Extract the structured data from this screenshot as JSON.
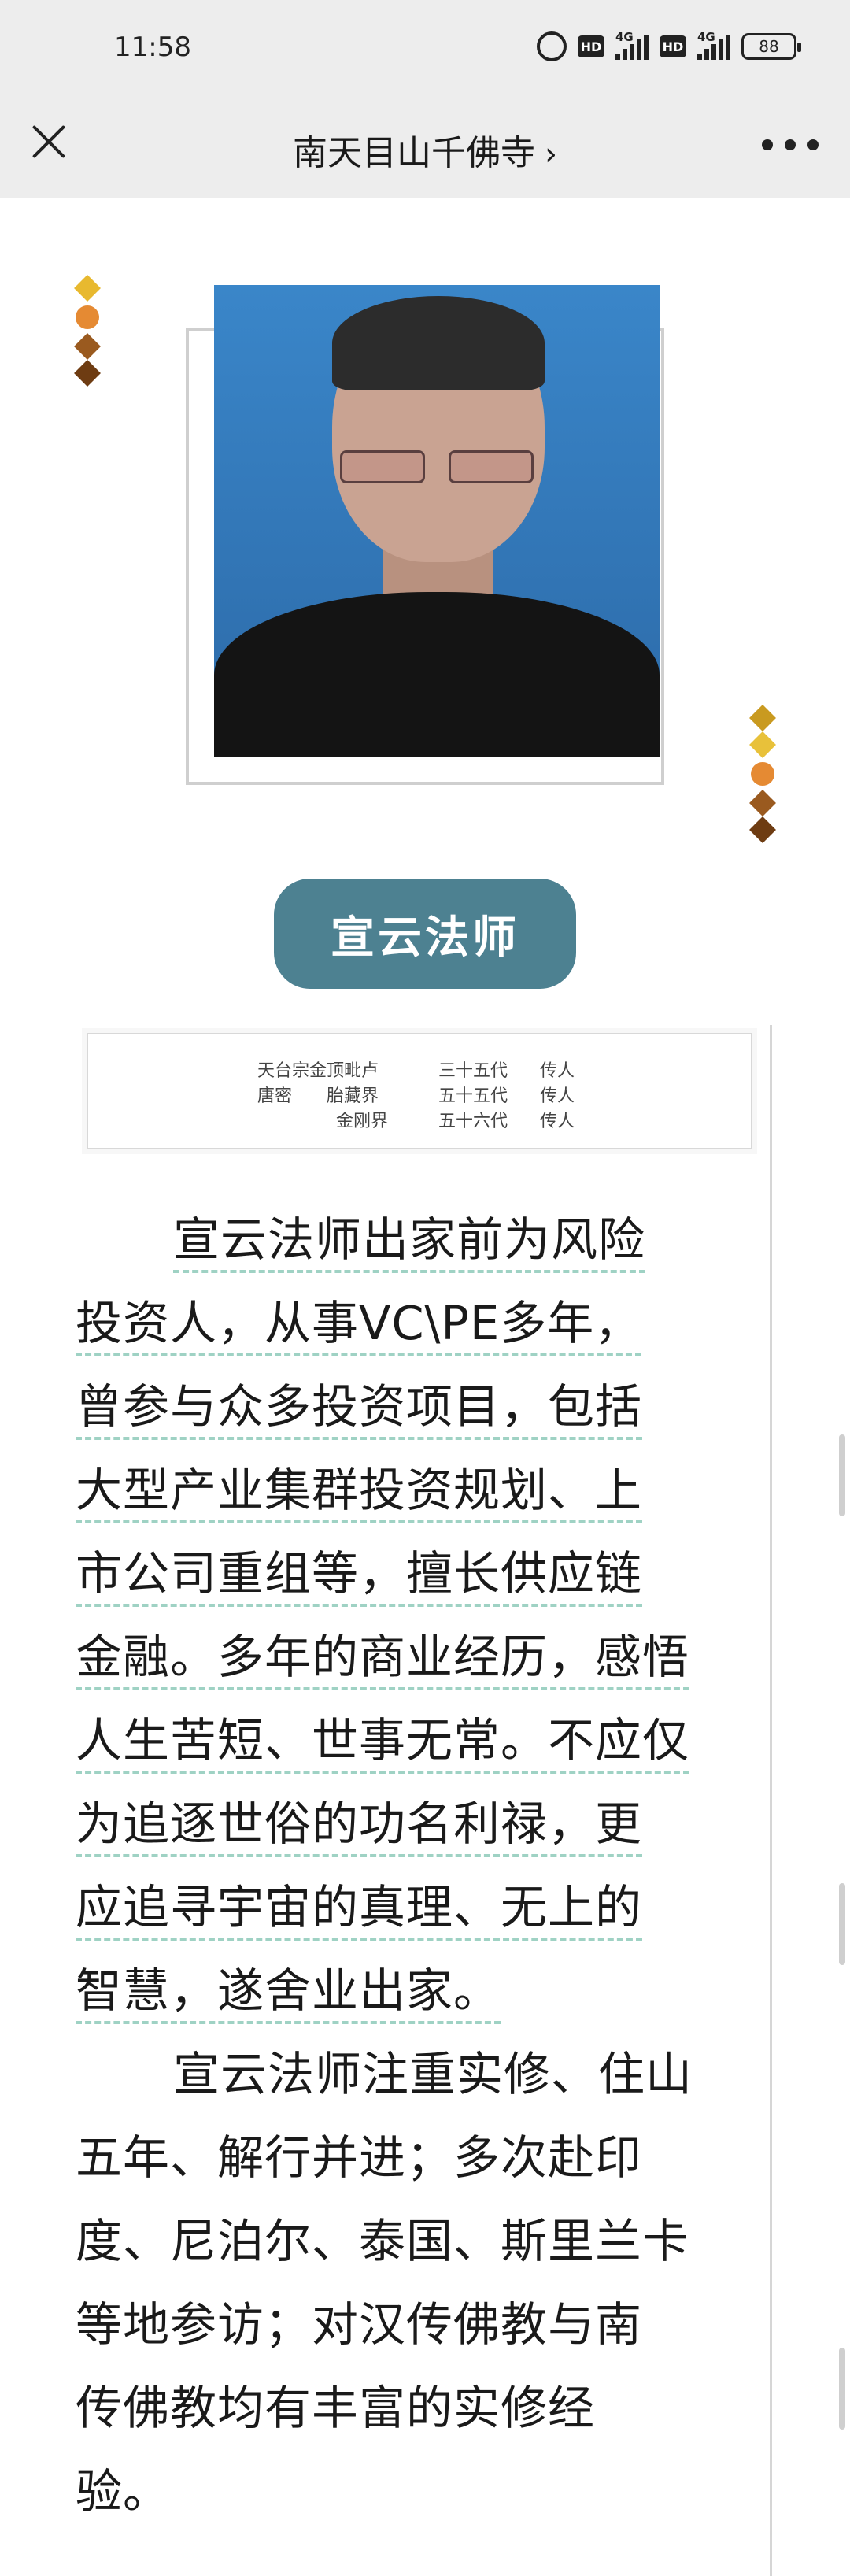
{
  "status_bar": {
    "time": "11:58",
    "network_1": "4G",
    "network_2": "4G",
    "hd_1": "HD",
    "hd_2": "HD",
    "battery": "88"
  },
  "nav": {
    "title": "南天目山千佛寺",
    "chevron": "›",
    "close_icon": "close-icon",
    "more_icon": "more-icon"
  },
  "profile": {
    "name_badge": "宣云法师"
  },
  "lineage": [
    {
      "school": "天台宗金顶毗卢",
      "generation": "三十五代",
      "role": "传人"
    },
    {
      "school": "唐密　　胎藏界",
      "generation": "五十五代",
      "role": "传人"
    },
    {
      "school": "金刚界",
      "generation": "五十六代",
      "role": "传人"
    }
  ],
  "article": {
    "paragraph1_lines": [
      "宣云法师出家前为风险",
      "投资人，从事VC\\PE多年，",
      "曾参与众多投资项目，包括",
      "大型产业集群投资规划、上",
      "市公司重组等，擅长供应链",
      "金融。多年的商业经历，感悟",
      "人生苦短、世事无常。不应仅",
      "为追逐世俗的功名利禄，更",
      "应追寻宇宙的真理、无上的",
      "智慧，遂舍业出家。"
    ],
    "paragraph2_lines": [
      "宣云法师注重实修、住山",
      "五年、解行并进；多次赴印",
      "度、尼泊尔、泰国、斯里兰卡",
      "等地参访；对汉传佛教与南",
      "传佛教均有丰富的实修经",
      "验。"
    ]
  },
  "colors": {
    "badge": "#4d8191",
    "underline": "#9fd2c4",
    "diamond_gold": "#e8b92f",
    "diamond_orange": "#e58a33",
    "diamond_brown": "#9a5a1f",
    "diamond_dark": "#6e3c12"
  }
}
